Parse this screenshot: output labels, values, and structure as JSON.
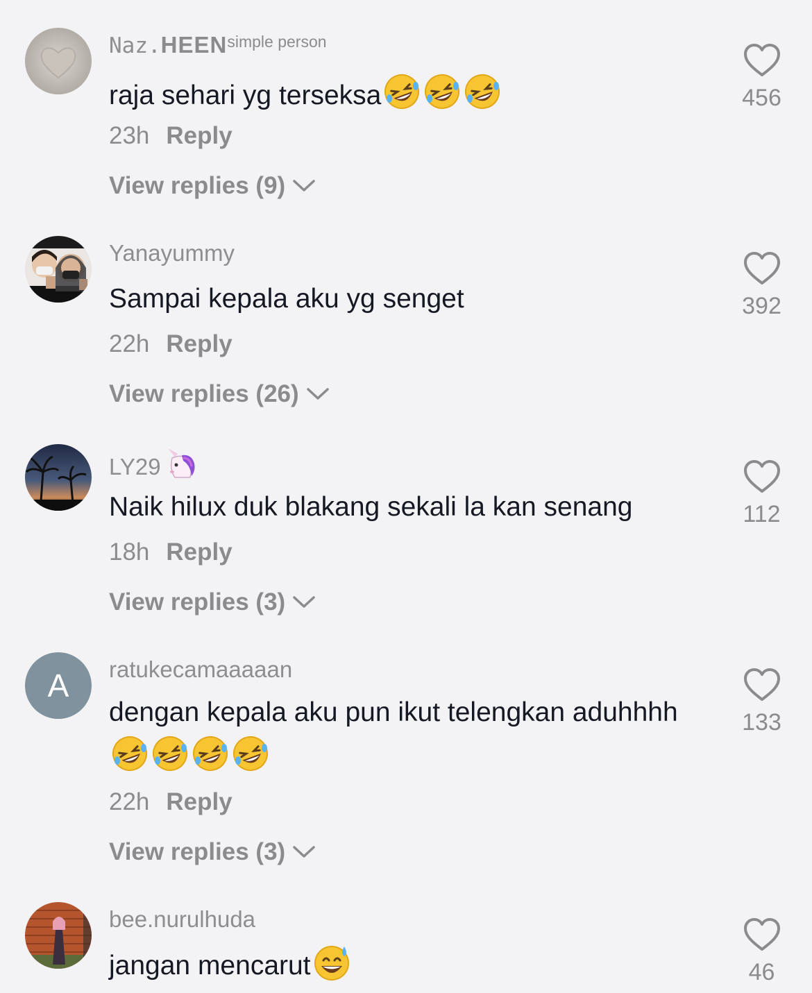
{
  "comments": [
    {
      "username_parts": [
        "Naz.",
        "HEEN",
        "simple person"
      ],
      "text": "raja sehari yg terseksa",
      "emojis": [
        "rofl-emoji",
        "rofl-emoji",
        "rofl-emoji"
      ],
      "time": "23h",
      "reply_label": "Reply",
      "view_replies": "View replies (9)",
      "likes": "456",
      "avatar": "heart-in-sand"
    },
    {
      "username": "Yanayummy",
      "text": "Sampai kepala aku yg senget",
      "time": "22h",
      "reply_label": "Reply",
      "view_replies": "View replies (26)",
      "likes": "392",
      "avatar": "couple-photo"
    },
    {
      "username": "LY29",
      "username_emoji": "unicorn-emoji",
      "text": "Naik hilux duk blakang sekali la kan senang",
      "time": "18h",
      "reply_label": "Reply",
      "view_replies": "View replies (3)",
      "likes": "112",
      "avatar": "palm-sunset"
    },
    {
      "username": "ratukecamaaaaan",
      "text": "dengan kepala aku pun ikut telengkan aduhhhh ",
      "emojis": [
        "rofl-emoji",
        "rofl-emoji",
        "rofl-emoji",
        "rofl-emoji"
      ],
      "time": "22h",
      "reply_label": "Reply",
      "view_replies": "View replies (3)",
      "likes": "133",
      "avatar_letter": "A"
    },
    {
      "username": "bee.nurulhuda",
      "text": "jangan mencarut",
      "emojis": [
        "grinning-sweat-emoji"
      ],
      "likes": "46",
      "avatar": "person-standing"
    }
  ],
  "colors": {
    "background": "#f3f3f5",
    "text": "#161823",
    "muted": "#8a8a8f"
  }
}
